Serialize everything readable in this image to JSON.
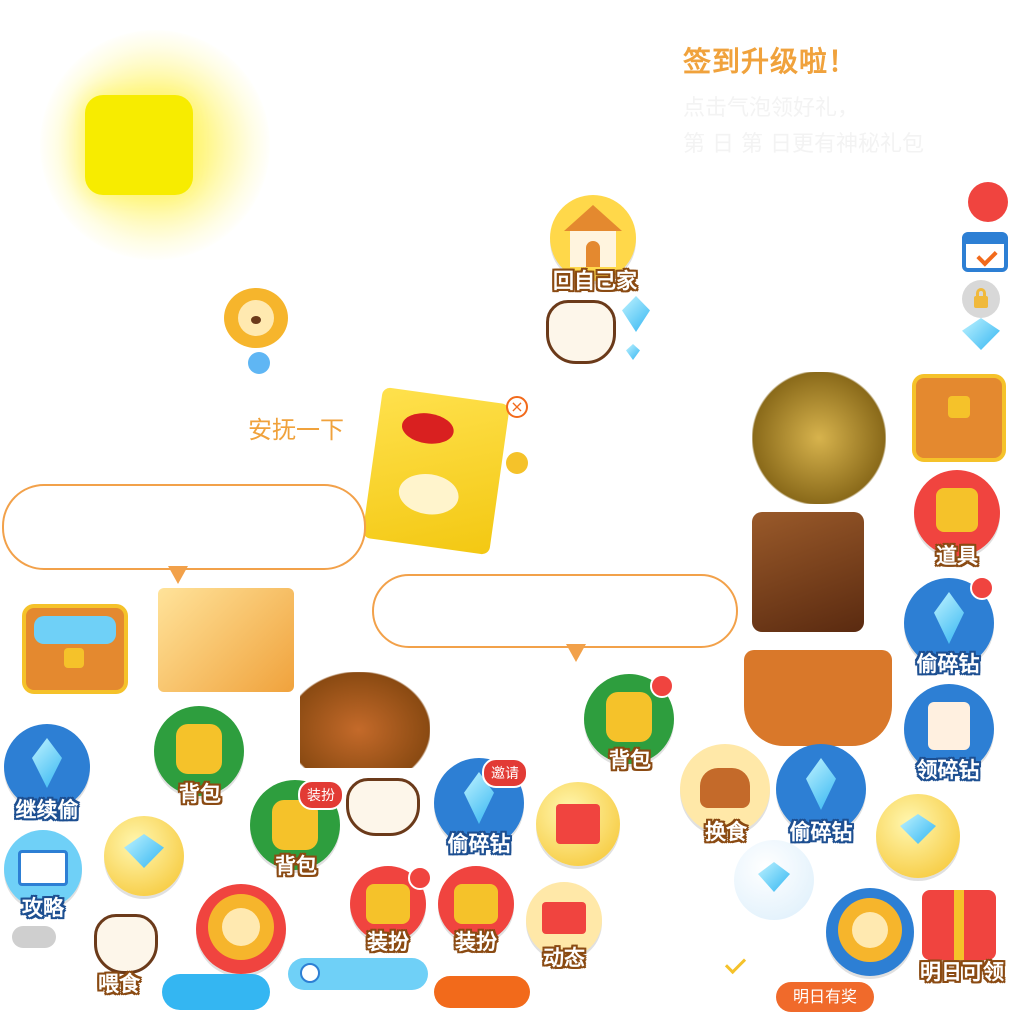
{
  "header": {
    "title": "签到升级啦！",
    "faint_line1": "点击气泡领好礼，",
    "faint_line2": "第 日 第 日更有神秘礼包"
  },
  "actions": {
    "home": "回自己家",
    "soothe": "安抚一下"
  },
  "buttons": {
    "backpack": "背包",
    "continue_steal": "继续偷",
    "guide": "攻略",
    "feed": "喂食",
    "steal_fragments": "偷碎钻",
    "dress_up": "装扮",
    "invite": "邀请",
    "news": "动态",
    "swap_food": "换食",
    "props": "道具",
    "claim_fragments": "领碎钻",
    "claim_tomorrow": "明日可领",
    "tomorrow_reward": "明日有奖"
  },
  "colors": {
    "accent_orange": "#f0a23c",
    "bubble_border": "#f2a14a",
    "pill_blue": "#34b6f2",
    "pill_orange": "#f26a1b",
    "red_dot": "#f0443f",
    "reward_pill": "#f06a2b"
  },
  "icons": [
    "sun-icon",
    "house-icon",
    "lion-icon",
    "hand-pointer-icon",
    "diamond-icon",
    "close-icon",
    "calendar-icon",
    "lock-icon",
    "treasure-chest-icon",
    "backpack-icon",
    "shirt-icon",
    "gift-icon",
    "mail-icon",
    "book-icon",
    "burger-icon",
    "clock-icon",
    "check-icon"
  ]
}
